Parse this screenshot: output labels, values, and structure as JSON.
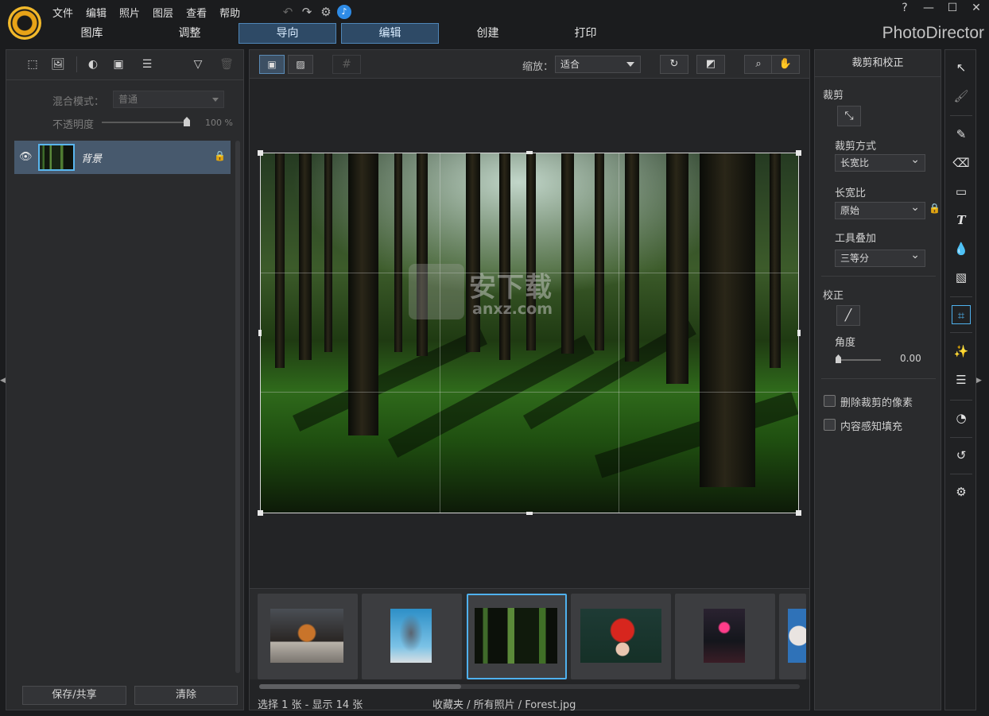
{
  "menu": [
    "文件",
    "编辑",
    "照片",
    "图层",
    "查看",
    "帮助"
  ],
  "quick_icons": [
    "undo-icon",
    "redo-icon",
    "settings-icon",
    "notification-icon"
  ],
  "window_controls": [
    "?",
    "—",
    "☐",
    "✕"
  ],
  "mode_tabs": [
    {
      "label": "图库",
      "active": false
    },
    {
      "label": "调整",
      "active": false
    },
    {
      "label": "导向",
      "active": true
    },
    {
      "label": "编辑",
      "active": true
    },
    {
      "label": "创建",
      "active": false
    },
    {
      "label": "打印",
      "active": false
    }
  ],
  "brand": "PhotoDirector",
  "layers": {
    "blend_label": "混合模式：",
    "blend_value": "普通",
    "opacity_label": "不透明度",
    "opacity_value": "100 %",
    "opacity_level": 1.0,
    "layer_name": "背景",
    "save_share": "保存/共享",
    "clear": "清除"
  },
  "toolbar": {
    "zoom_label": "缩放：",
    "zoom_value": "适合"
  },
  "watermark": {
    "text": "安下载",
    "sub": "anxz.com"
  },
  "filmstrip": {
    "items": [
      "basketball",
      "rock-boat",
      "forest",
      "red-leaf",
      "neon-building",
      "clouds"
    ],
    "selected": 2
  },
  "status": {
    "selection": "选择 1 张 - 显示 14 张",
    "path": "收藏夹 / 所有照片 / Forest.jpg"
  },
  "right_panel": {
    "title": "裁剪和校正",
    "crop_section": "裁剪",
    "crop_method_label": "裁剪方式",
    "crop_method_value": "长宽比",
    "aspect_label": "长宽比",
    "aspect_value": "原始",
    "overlay_label": "工具叠加",
    "overlay_value": "三等分",
    "straighten_section": "校正",
    "angle_label": "角度",
    "angle_value": "0.00",
    "delete_cropped_label": "删除裁剪的像素",
    "content_aware_label": "内容感知填充"
  },
  "colors": {
    "accent": "#4fb1ee",
    "active_tab": "#2e4a66",
    "panel_bg": "#2a2b2d"
  }
}
